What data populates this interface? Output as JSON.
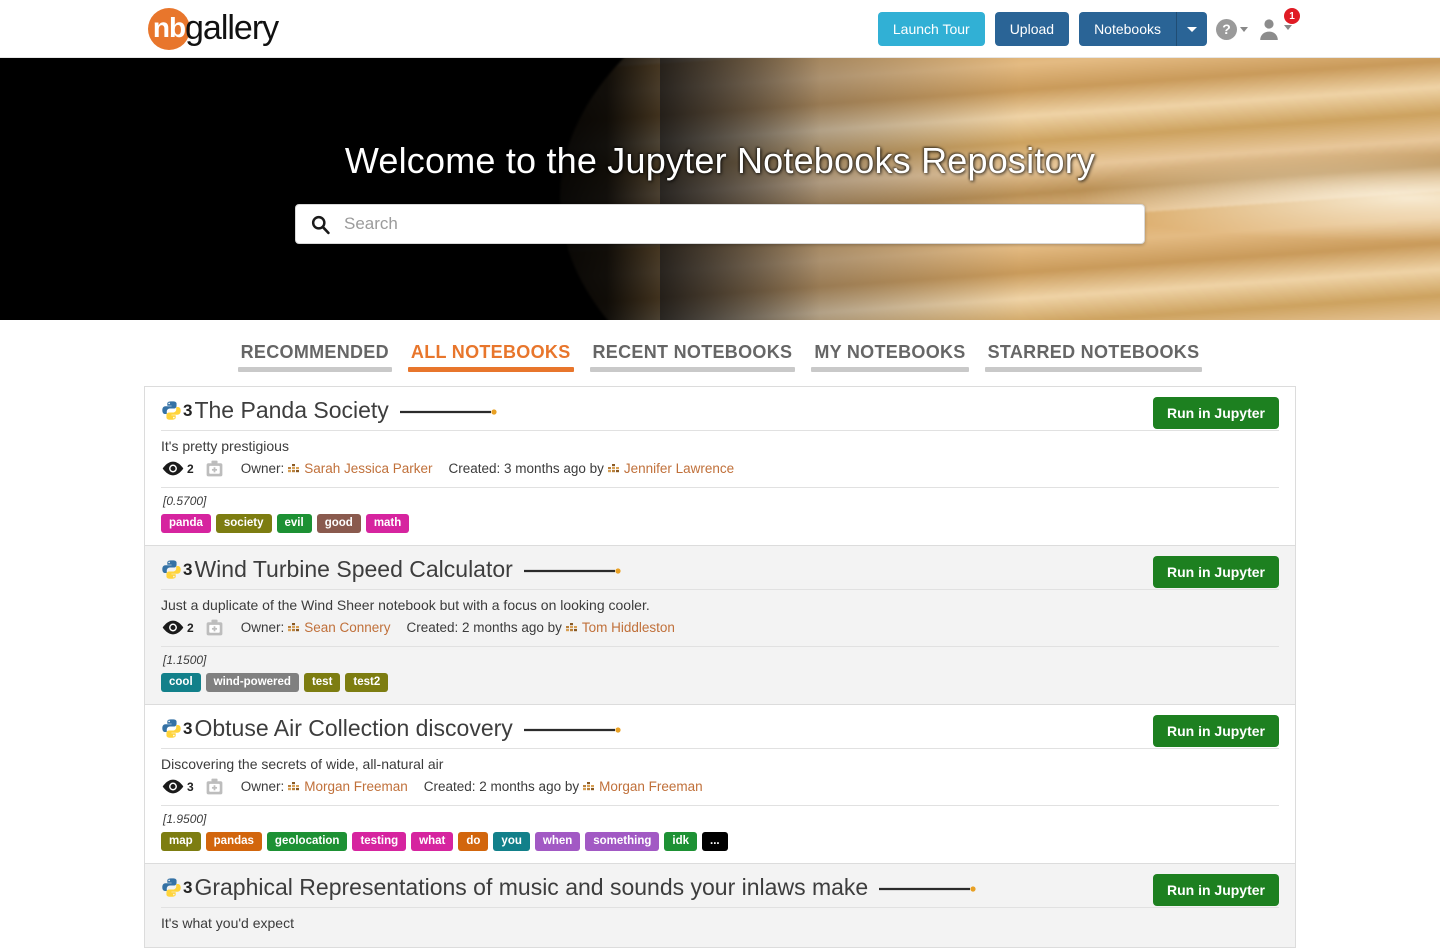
{
  "header": {
    "brand_mark": "nb",
    "brand_text": "gallery",
    "brand_color": "#e8762c",
    "launch_tour_label": "Launch Tour",
    "upload_label": "Upload",
    "notebooks_label": "Notebooks",
    "help_glyph": "?",
    "help_icon_name": "question-circle-icon",
    "user_icon_name": "user-avatar-icon",
    "notification_count": "1",
    "notification_color": "#e01b24"
  },
  "hero": {
    "title": "Welcome to the Jupyter Notebooks Repository",
    "search_placeholder": "Search",
    "search_value": "",
    "search_icon_name": "search-icon"
  },
  "tabs": [
    {
      "label": "RECOMMENDED",
      "active": false
    },
    {
      "label": "ALL NOTEBOOKS",
      "active": true
    },
    {
      "label": "RECENT NOTEBOOKS",
      "active": false
    },
    {
      "label": "MY NOTEBOOKS",
      "active": false
    },
    {
      "label": "STARRED NOTEBOOKS",
      "active": false
    }
  ],
  "accent_color": "#e8762c",
  "run_button_color": "#1d8020",
  "run_button_label": "Run in Jupyter",
  "labels": {
    "owner": "Owner:",
    "created": "Created:",
    "by": "by",
    "python_version": "3"
  },
  "notebooks": [
    {
      "title": "The Panda Society",
      "python_version": "3",
      "description": "It's pretty prestigious",
      "views": "2",
      "owner": "Sarah Jessica Parker",
      "created": "3 months ago",
      "creator": "Jennifer Lawrence",
      "score": "[0.5700]",
      "run_label": "Run in Jupyter",
      "tags": [
        {
          "label": "panda",
          "color": "#d6249f"
        },
        {
          "label": "society",
          "color": "#7d7d11"
        },
        {
          "label": "evil",
          "color": "#1d9134"
        },
        {
          "label": "good",
          "color": "#8a5a4e"
        },
        {
          "label": "math",
          "color": "#d6249f"
        }
      ]
    },
    {
      "title": "Wind Turbine Speed Calculator",
      "python_version": "3",
      "description": "Just a duplicate of the Wind Sheer notebook but with a focus on looking cooler.",
      "views": "2",
      "owner": "Sean Connery",
      "created": "2 months ago",
      "creator": "Tom Hiddleston",
      "score": "[1.1500]",
      "run_label": "Run in Jupyter",
      "tags": [
        {
          "label": "cool",
          "color": "#12808a"
        },
        {
          "label": "wind-powered",
          "color": "#808080"
        },
        {
          "label": "test",
          "color": "#7d7d11"
        },
        {
          "label": "test2",
          "color": "#7d7d11"
        }
      ]
    },
    {
      "title": "Obtuse Air Collection discovery",
      "python_version": "3",
      "description": "Discovering the secrets of wide, all-natural air",
      "views": "3",
      "owner": "Morgan Freeman",
      "created": "2 months ago",
      "creator": "Morgan Freeman",
      "score": "[1.9500]",
      "run_label": "Run in Jupyter",
      "tags": [
        {
          "label": "map",
          "color": "#7d7d11"
        },
        {
          "label": "pandas",
          "color": "#d2660d"
        },
        {
          "label": "geolocation",
          "color": "#1d9134"
        },
        {
          "label": "testing",
          "color": "#d6249f"
        },
        {
          "label": "what",
          "color": "#d6249f"
        },
        {
          "label": "do",
          "color": "#d2660d"
        },
        {
          "label": "you",
          "color": "#12808a"
        },
        {
          "label": "when",
          "color": "#a259c4"
        },
        {
          "label": "something",
          "color": "#a259c4"
        },
        {
          "label": "idk",
          "color": "#1d9134"
        },
        {
          "label": "...",
          "color": "#000000"
        }
      ]
    },
    {
      "title": "Graphical Representations of music and sounds your inlaws make",
      "python_version": "3",
      "description": "It's what you'd expect",
      "views": "",
      "owner": "",
      "created": "",
      "creator": "",
      "score": "",
      "run_label": "Run in Jupyter",
      "tags": []
    }
  ]
}
